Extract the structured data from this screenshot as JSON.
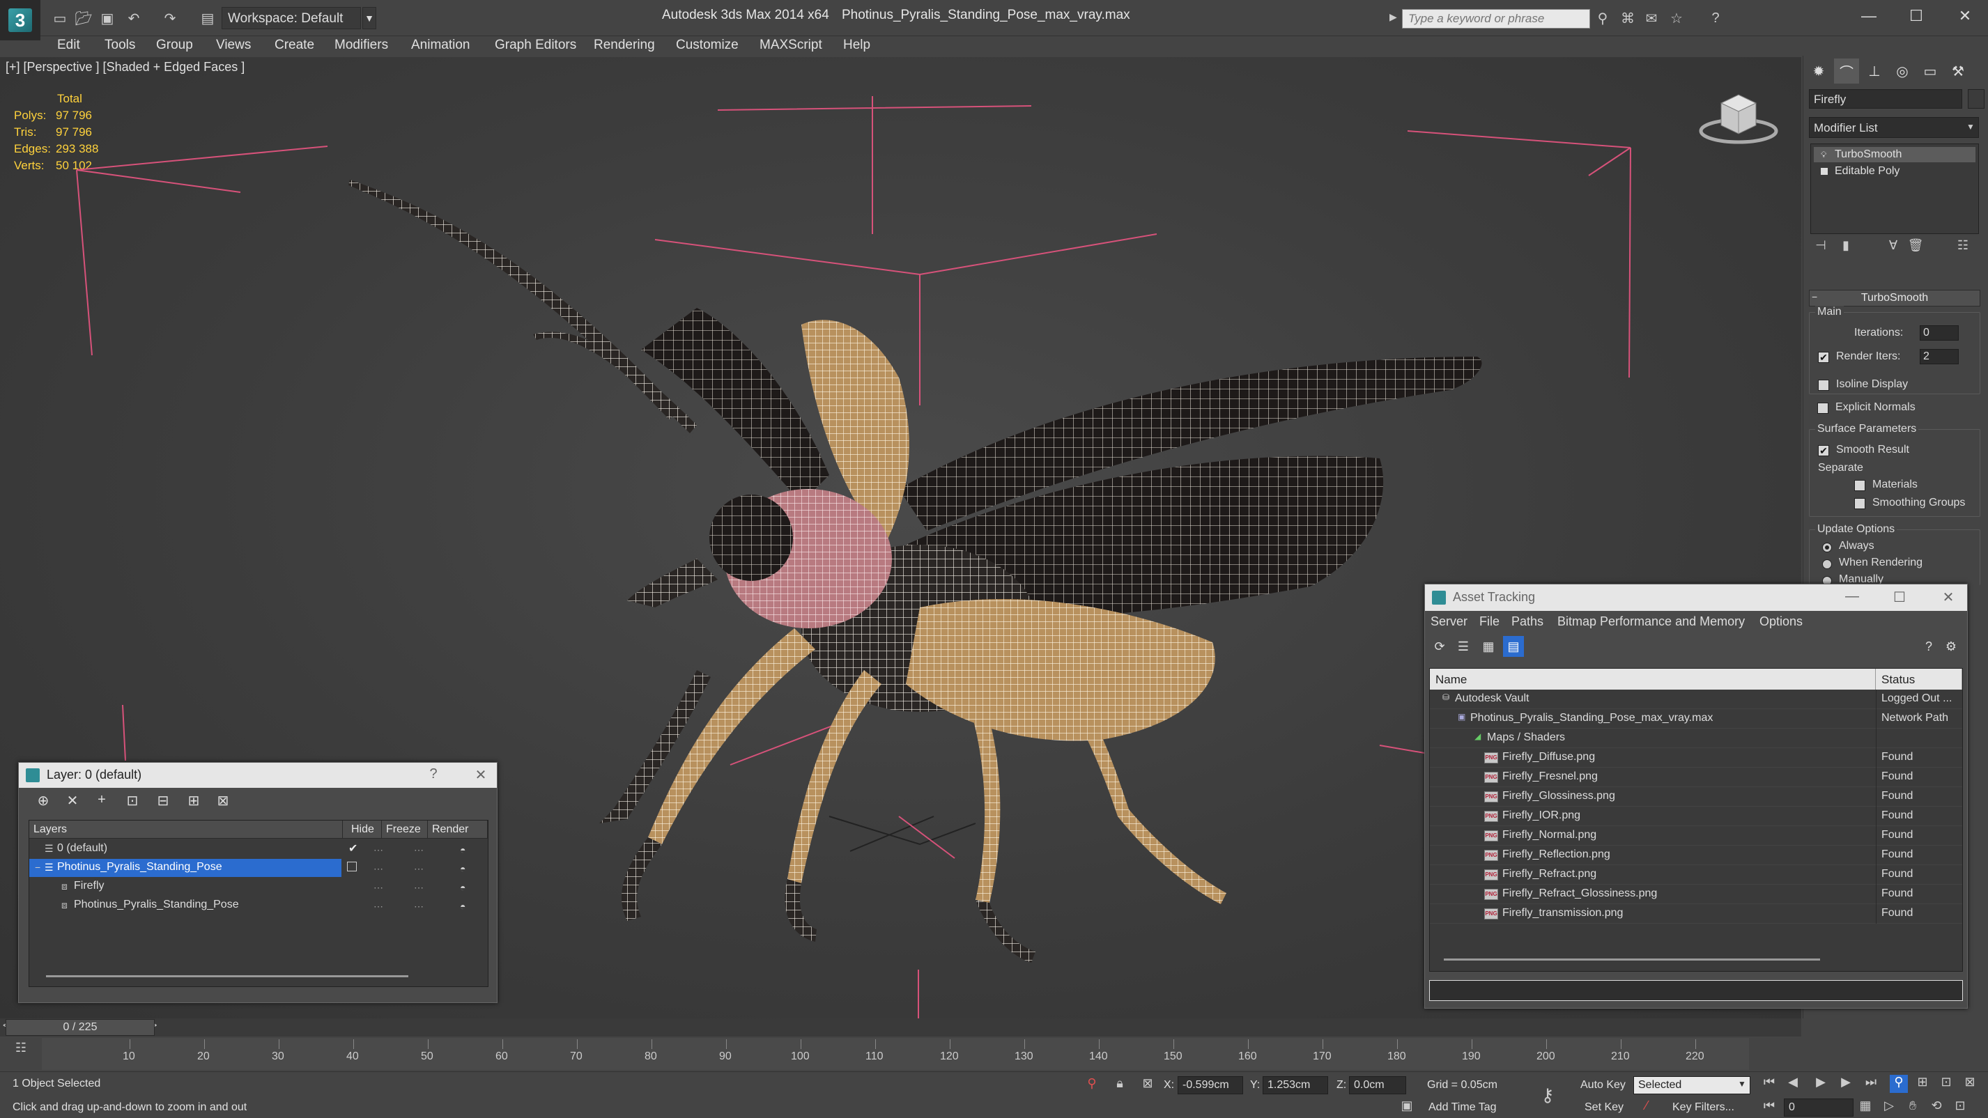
{
  "titlebar": {
    "workspace": "Workspace: Default",
    "app_title": "Autodesk 3ds Max  2014 x64",
    "file_title": "Photinus_Pyralis_Standing_Pose_max_vray.max",
    "search_placeholder": "Type a keyword or phrase"
  },
  "menu": [
    "Edit",
    "Tools",
    "Group",
    "Views",
    "Create",
    "Modifiers",
    "Animation",
    "Graph Editors",
    "Rendering",
    "Customize",
    "MAXScript",
    "Help"
  ],
  "viewport": {
    "label": "[+] [Perspective ] [Shaded + Edged Faces ]",
    "stats_header": "Total",
    "stats": [
      {
        "label": "Polys:",
        "value": "97 796"
      },
      {
        "label": "Tris:",
        "value": "97 796"
      },
      {
        "label": "Edges:",
        "value": "293 388"
      },
      {
        "label": "Verts:",
        "value": "50 102"
      }
    ]
  },
  "command_panel": {
    "object_name": "Firefly",
    "modifier_list": "Modifier List",
    "stack": [
      "TurboSmooth",
      "Editable Poly"
    ],
    "rollout_title": "TurboSmooth",
    "main_group": "Main",
    "iterations_label": "Iterations:",
    "iterations_value": "0",
    "render_iters_label": "Render Iters:",
    "render_iters_value": "2",
    "isoline": "Isoline Display",
    "explicit": "Explicit Normals",
    "surface_group": "Surface Parameters",
    "smooth_result": "Smooth Result",
    "separate": "Separate",
    "materials": "Materials",
    "smoothing_groups": "Smoothing Groups",
    "update_group": "Update Options",
    "always": "Always",
    "when_rendering": "When Rendering",
    "manually": "Manually"
  },
  "layer_dialog": {
    "title": "Layer: 0 (default)",
    "help": "?",
    "headers": [
      "Layers",
      "Hide",
      "Freeze",
      "Render"
    ],
    "rows": [
      {
        "name": "0 (default)"
      },
      {
        "name": "Photinus_Pyralis_Standing_Pose"
      },
      {
        "name": "Firefly"
      },
      {
        "name": "Photinus_Pyralis_Standing_Pose"
      }
    ]
  },
  "asset_dialog": {
    "title": "Asset Tracking",
    "menu": [
      "Server",
      "File",
      "Paths",
      "Bitmap Performance and Memory",
      "Options"
    ],
    "headers": [
      "Name",
      "Status"
    ],
    "rows": [
      {
        "name": "Autodesk Vault",
        "status": "Logged Out ..."
      },
      {
        "name": "Photinus_Pyralis_Standing_Pose_max_vray.max",
        "status": "Network Path"
      },
      {
        "name": "Maps / Shaders",
        "status": ""
      },
      {
        "name": "Firefly_Diffuse.png",
        "status": "Found"
      },
      {
        "name": "Firefly_Fresnel.png",
        "status": "Found"
      },
      {
        "name": "Firefly_Glossiness.png",
        "status": "Found"
      },
      {
        "name": "Firefly_IOR.png",
        "status": "Found"
      },
      {
        "name": "Firefly_Normal.png",
        "status": "Found"
      },
      {
        "name": "Firefly_Reflection.png",
        "status": "Found"
      },
      {
        "name": "Firefly_Refract.png",
        "status": "Found"
      },
      {
        "name": "Firefly_Refract_Glossiness.png",
        "status": "Found"
      },
      {
        "name": "Firefly_transmission.png",
        "status": "Found"
      }
    ],
    "png_badge": "PNG"
  },
  "timeline": {
    "frame": "0 / 225",
    "ticks": [
      "10",
      "20",
      "30",
      "40",
      "50",
      "60",
      "70",
      "80",
      "90",
      "100",
      "110",
      "120",
      "130",
      "140",
      "150",
      "160",
      "170",
      "180",
      "190",
      "200",
      "210",
      "220"
    ]
  },
  "status": {
    "selected": "1 Object Selected",
    "hint": "Click and drag up-and-down to zoom in and out",
    "x_label": "X:",
    "x_value": "-0.599cm",
    "y_label": "Y:",
    "y_value": "1.253cm",
    "z_label": "Z:",
    "z_value": "0.0cm",
    "grid": "Grid = 0.05cm",
    "add_time_tag": "Add Time Tag",
    "auto_key": "Auto Key",
    "selected_dropdown": "Selected",
    "set_key": "Set Key",
    "key_filters": "Key Filters...",
    "frame_value": "0"
  }
}
